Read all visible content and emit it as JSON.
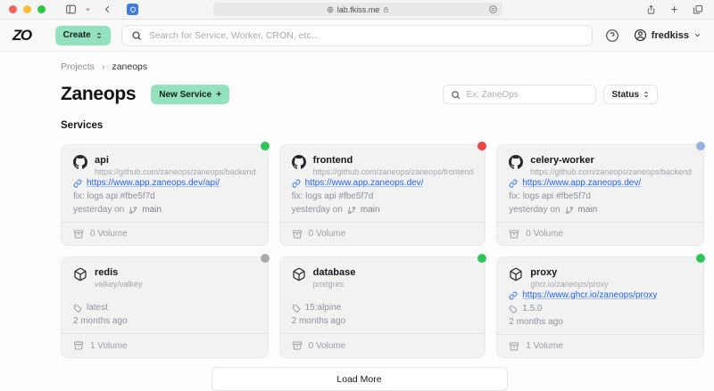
{
  "browser": {
    "url": "lab.fkiss.me"
  },
  "header": {
    "logo": "ZO",
    "create_label": "Create",
    "search_placeholder": "Search for Service, Worker, CRON, etc...",
    "username": "fredkiss"
  },
  "breadcrumb": {
    "root": "Projects",
    "separator": "›",
    "current": "zaneops"
  },
  "page": {
    "title": "Zaneops",
    "new_service_label": "New Service",
    "new_service_plus": "+",
    "filter_placeholder": "Ex: ZaneOps",
    "status_label": "Status",
    "section_title": "Services",
    "load_more_label": "Load More"
  },
  "colors": {
    "accent_mint": "#94e1c0",
    "link_blue": "#2563eb",
    "status_green": "#2fc559",
    "status_red": "#ee4444",
    "status_blue": "#93b4e0",
    "status_gray": "#a8a8ad"
  },
  "services": [
    {
      "name": "api",
      "source_type": "git",
      "source": "https://github.com/zaneops/zaneops/backend",
      "link": "https://www.app.zaneops.dev/api/",
      "commit": "fix: logs api #fbe5f7d",
      "updated": "yesterday on",
      "branch": "main",
      "volumes": "0 Volume",
      "status_color": "#2fc559"
    },
    {
      "name": "frontend",
      "source_type": "git",
      "source": "https://github.com/zaneops/zaneops/frontend",
      "link": "https://www.app.zaneops.dev/",
      "commit": "fix: logs api #fbe5f7d",
      "updated": "yesterday on",
      "branch": "main",
      "volumes": "0 Volume",
      "status_color": "#ee4444"
    },
    {
      "name": "celery-worker",
      "source_type": "git",
      "source": "https://github.com/zaneops/zaneops/backend",
      "link": "https://www.app.zaneops.dev/",
      "commit": "fix: logs api #fbe5f7d",
      "updated": "yesterday on",
      "branch": "main",
      "volumes": "0 Volume",
      "status_color": "#93b4e0"
    },
    {
      "name": "redis",
      "source_type": "docker",
      "source": "valkey/valkey",
      "tag": "latest",
      "updated": "2 months ago",
      "volumes": "1 Volume",
      "status_color": "#a8a8ad"
    },
    {
      "name": "database",
      "source_type": "docker",
      "source": "postgres",
      "tag": "15:alpine",
      "updated": "2 months ago",
      "volumes": "0 Volume",
      "status_color": "#2fc559"
    },
    {
      "name": "proxy",
      "source_type": "docker",
      "source": "ghcr.io/zaneops/proxy",
      "link": "https://www.ghcr.io/zaneops/proxy",
      "tag": "1.5.0",
      "updated": "2 months ago",
      "volumes": "1 Volume",
      "status_color": "#2fc559"
    }
  ]
}
